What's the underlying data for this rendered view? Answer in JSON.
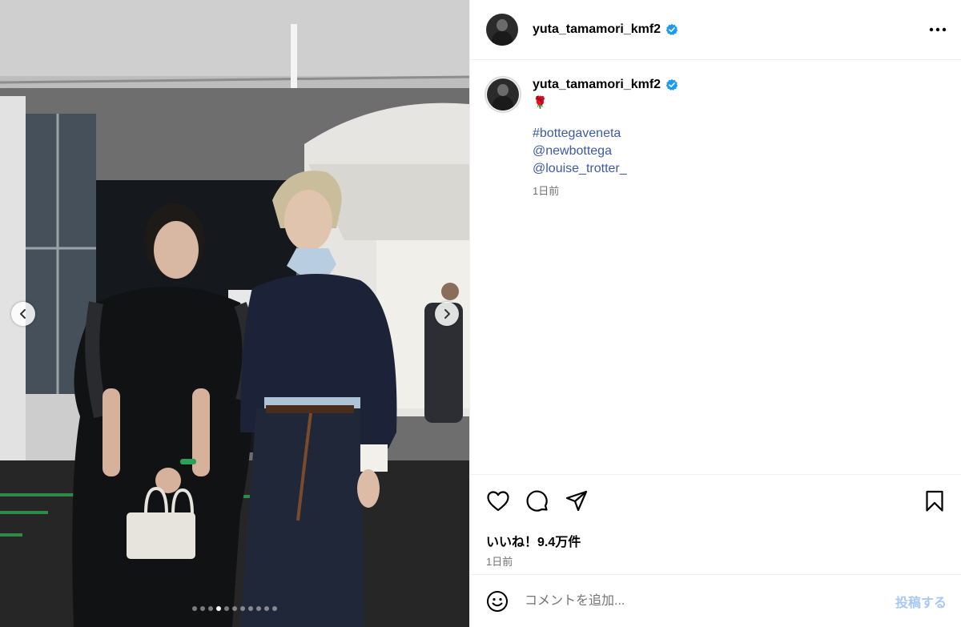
{
  "post": {
    "username": "yuta_tamamori_kmf2",
    "verified": true,
    "caption_emoji": "🌹",
    "caption_lines": [
      "#bottegaveneta",
      "@newbottega",
      "@louise_trotter_"
    ],
    "caption_time": "1日前",
    "likes_text": "いいね！9.4万件",
    "post_time": "1日前"
  },
  "comment": {
    "placeholder": "コメントを追加...",
    "post_label": "投稿する"
  },
  "carousel": {
    "slide_count": 11,
    "active_index": 3
  },
  "icons": {
    "verified": "verified-badge-icon",
    "more": "more-options-icon",
    "like": "heart-icon",
    "comment": "comment-bubble-icon",
    "share": "paper-plane-icon",
    "save": "bookmark-icon",
    "emoji": "smiley-icon",
    "prev": "chevron-left-icon",
    "next": "chevron-right-icon"
  },
  "colors": {
    "verified": "#1d9bf0",
    "link": "#3d5aa8",
    "muted": "#737373",
    "post_button": "#a6c8f5"
  }
}
